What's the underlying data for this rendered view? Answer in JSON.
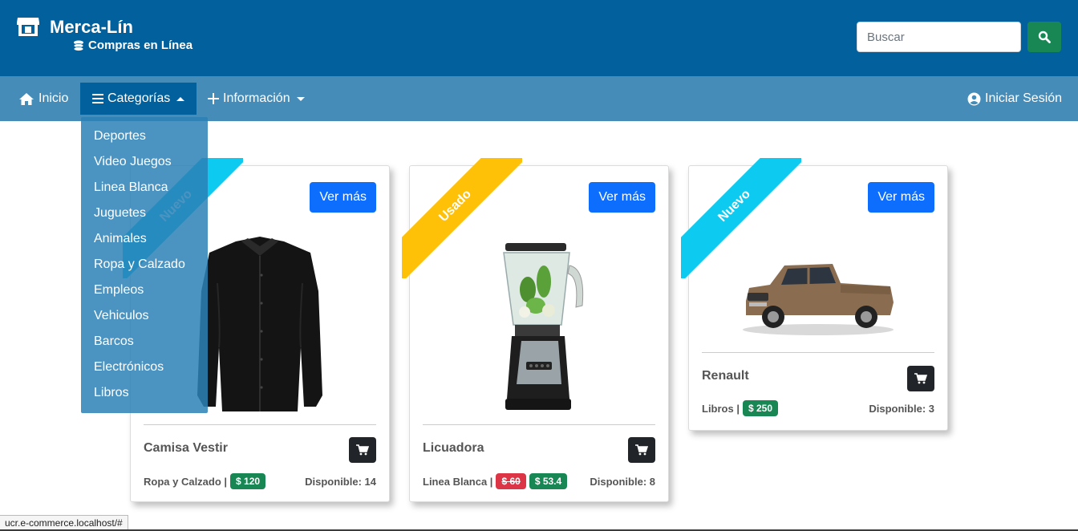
{
  "header": {
    "brand": "Merca-Lín",
    "subtitle": "Compras en Línea",
    "search_placeholder": "Buscar"
  },
  "nav": {
    "inicio": "Inicio",
    "categorias": "Categorías",
    "informacion": "Información",
    "login": "Iniciar Sesión"
  },
  "categories": [
    "Deportes",
    "Video Juegos",
    "Linea Blanca",
    "Juguetes",
    "Animales",
    "Ropa y Calzado",
    "Empleos",
    "Vehiculos",
    "Barcos",
    "Electrónicos",
    "Libros"
  ],
  "products": [
    {
      "ribbon": "Nuevo",
      "ribbon_color": "#0dcaf0",
      "button": "Ver más",
      "name": "Camisa Vestir",
      "category": "Ropa y Calzado |",
      "price": "$ 120",
      "available": "Disponible: 14"
    },
    {
      "ribbon": "Usado",
      "ribbon_color": "#ffc107",
      "button": "Ver más",
      "name": "Licuadora",
      "category": "Linea Blanca |",
      "old_price": "$ 60",
      "price": "$ 53.4",
      "available": "Disponible: 8"
    },
    {
      "ribbon": "Nuevo",
      "ribbon_color": "#0dcaf0",
      "button": "Ver más",
      "name": "Renault",
      "category": "Libros |",
      "price": "$ 250",
      "available": "Disponible: 3"
    }
  ],
  "status_url": "ucr.e-commerce.localhost/#",
  "colors": {
    "header": "#02619c",
    "navbar": "#468cb8",
    "primary": "#0d6efd",
    "success": "#198754",
    "danger": "#dc3545"
  }
}
